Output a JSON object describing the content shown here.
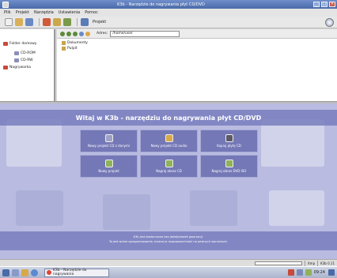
{
  "window": {
    "title": "K3b - Narzędzie do nagrywania płyt CD/DVD",
    "controls": {
      "minimize": "_",
      "maximize": "□",
      "close": "×"
    }
  },
  "menu": [
    "Plik",
    "Projekt",
    "Narzędzia",
    "Ustawienia",
    "Pomoc"
  ],
  "toolbar": {
    "project_label": "Projekt"
  },
  "tree": [
    {
      "label": "Folder domowy",
      "icon": "home-folder-icon"
    },
    {
      "label": "CD-ROM",
      "icon": "cdrom-drive-icon"
    },
    {
      "label": "CD-RW",
      "icon": "cdrw-drive-icon"
    },
    {
      "label": "Nagrywarka",
      "icon": "burner-drive-icon"
    }
  ],
  "filebrowser": {
    "address_label": "Adres:",
    "address_value": "/home/user",
    "items": [
      "Dokumenty",
      "Pulpit"
    ]
  },
  "welcome": {
    "title": "Witaj w K3b - narzędziu do nagrywania płyt CD/DVD",
    "actions": [
      {
        "label": "Nowy projekt CD z danymi",
        "icon": "data-cd-icon",
        "color": "#9fa2c4"
      },
      {
        "label": "Nowy projekt CD audio",
        "icon": "audio-cd-icon",
        "color": "#d9a84a"
      },
      {
        "label": "Kopiuj płytę CD",
        "icon": "copy-cd-icon",
        "color": "#5a5a6a"
      },
      {
        "label": "Nowy projekt",
        "icon": "new-project-icon",
        "color": "#8fb25a"
      },
      {
        "label": "Nagraj obraz CD",
        "icon": "burn-cd-image-icon",
        "color": "#8fb25a"
      },
      {
        "label": "Nagraj obraz DVD ISO",
        "icon": "burn-dvd-image-icon",
        "color": "#8fb25a"
      }
    ],
    "info_line1": "K3b jest dostarczane bez jakiejkolwiek gwarancji.",
    "info_line2": "To jest wolne oprogramowanie; można je rozpowszechniać na pewnych warunkach."
  },
  "statusbar": {
    "temp": "/tmp",
    "version": "K3b 0.11"
  },
  "taskbar": {
    "window_label": "K3b - Narzędzie do nagrywania",
    "clock": "09:24"
  },
  "colors": {
    "titlebar": "#4a6aa8",
    "welcome_bg": "#b9bce0",
    "welcome_band": "#787ebe",
    "action_button": "#7478b6"
  }
}
